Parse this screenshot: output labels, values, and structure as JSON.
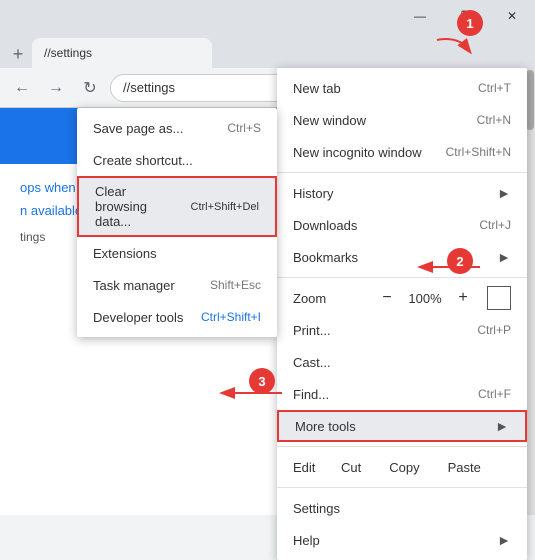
{
  "browser": {
    "new_tab_icon": "+",
    "url": "//settings",
    "star_icon": "☆",
    "profile_icon": "👤",
    "menu_icon": "⋮",
    "minimize": "—",
    "restore": "❐",
    "close": "✕"
  },
  "annotations": [
    {
      "id": "1",
      "label": "1"
    },
    {
      "id": "2",
      "label": "2"
    },
    {
      "id": "3",
      "label": "3"
    }
  ],
  "settings": {
    "header_text": "",
    "line1": "ops when Google Chrome is closed",
    "line2": "n available",
    "line3": "tings"
  },
  "menu": {
    "sections": [
      {
        "items": [
          {
            "label": "New tab",
            "shortcut": "Ctrl+T",
            "has_arrow": false
          },
          {
            "label": "New window",
            "shortcut": "Ctrl+N",
            "has_arrow": false
          },
          {
            "label": "New incognito window",
            "shortcut": "Ctrl+Shift+N",
            "has_arrow": false
          }
        ]
      },
      {
        "items": [
          {
            "label": "History",
            "shortcut": "",
            "has_arrow": true
          },
          {
            "label": "Downloads",
            "shortcut": "Ctrl+J",
            "has_arrow": false
          },
          {
            "label": "Bookmarks",
            "shortcut": "",
            "has_arrow": true
          }
        ]
      },
      {
        "zoom_label": "Zoom",
        "zoom_minus": "−",
        "zoom_value": "100%",
        "zoom_plus": "+",
        "items": [
          {
            "label": "Print...",
            "shortcut": "Ctrl+P",
            "has_arrow": false
          },
          {
            "label": "Cast...",
            "shortcut": "",
            "has_arrow": false
          },
          {
            "label": "Find...",
            "shortcut": "Ctrl+F",
            "has_arrow": false
          },
          {
            "label": "More tools",
            "shortcut": "",
            "has_arrow": true,
            "highlighted": true
          }
        ]
      },
      {
        "edit_label": "Edit",
        "edit_buttons": [
          "Cut",
          "Copy",
          "Paste"
        ],
        "items": [
          {
            "label": "Settings",
            "shortcut": "",
            "has_arrow": false
          },
          {
            "label": "Help",
            "shortcut": "",
            "has_arrow": true
          }
        ]
      }
    ]
  },
  "submenu": {
    "items": [
      {
        "label": "Save page as...",
        "shortcut": "Ctrl+S",
        "highlighted": false
      },
      {
        "label": "Create shortcut...",
        "shortcut": "",
        "highlighted": false
      },
      {
        "label": "Clear browsing data...",
        "shortcut": "Ctrl+Shift+Del",
        "highlighted": true
      },
      {
        "label": "Extensions",
        "shortcut": "",
        "highlighted": false
      },
      {
        "label": "Task manager",
        "shortcut": "Shift+Esc",
        "highlighted": false
      },
      {
        "label": "Developer tools",
        "shortcut": "Ctrl+Shift+I",
        "highlighted": false,
        "shortcut_color": "blue"
      }
    ]
  }
}
